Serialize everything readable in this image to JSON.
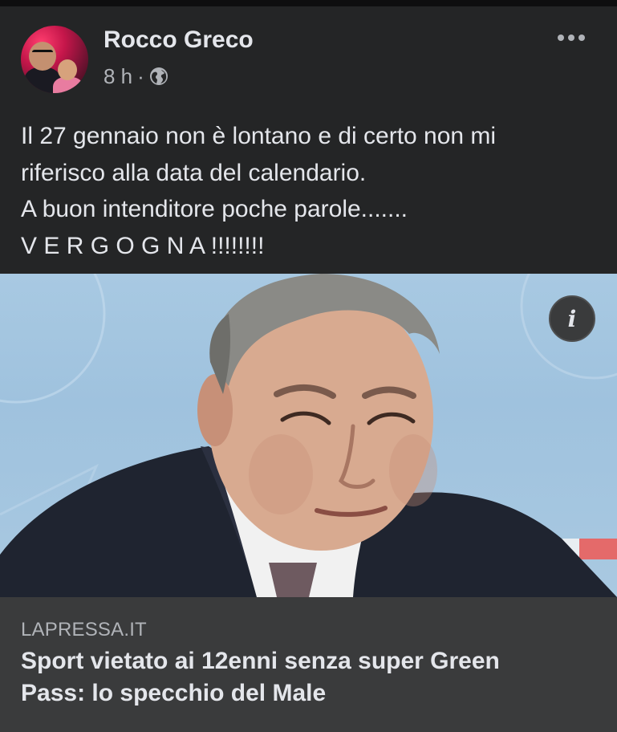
{
  "post": {
    "author": "Rocco Greco",
    "timestamp": "8 h",
    "separator": "·",
    "audience_icon": "globe-icon",
    "more_icon": "more-options-icon",
    "text_lines": [
      "Il 27 gennaio non è lontano e di certo non mi",
      "riferisco alla data del calendario.",
      "A buon intenditore poche parole.......",
      "V E R G O G N A !!!!!!!!"
    ]
  },
  "link_preview": {
    "image_icon": "info-icon",
    "info_label": "i",
    "domain": "LAPRESSA.IT",
    "title_lines": [
      "Sport vietato ai 12enni senza super Green",
      "Pass: lo specchio del Male"
    ]
  },
  "colors": {
    "card_background": "#242526",
    "link_footer_background": "#3a3b3c",
    "primary_text": "#e4e6eb",
    "secondary_text": "#b0b3b8"
  }
}
